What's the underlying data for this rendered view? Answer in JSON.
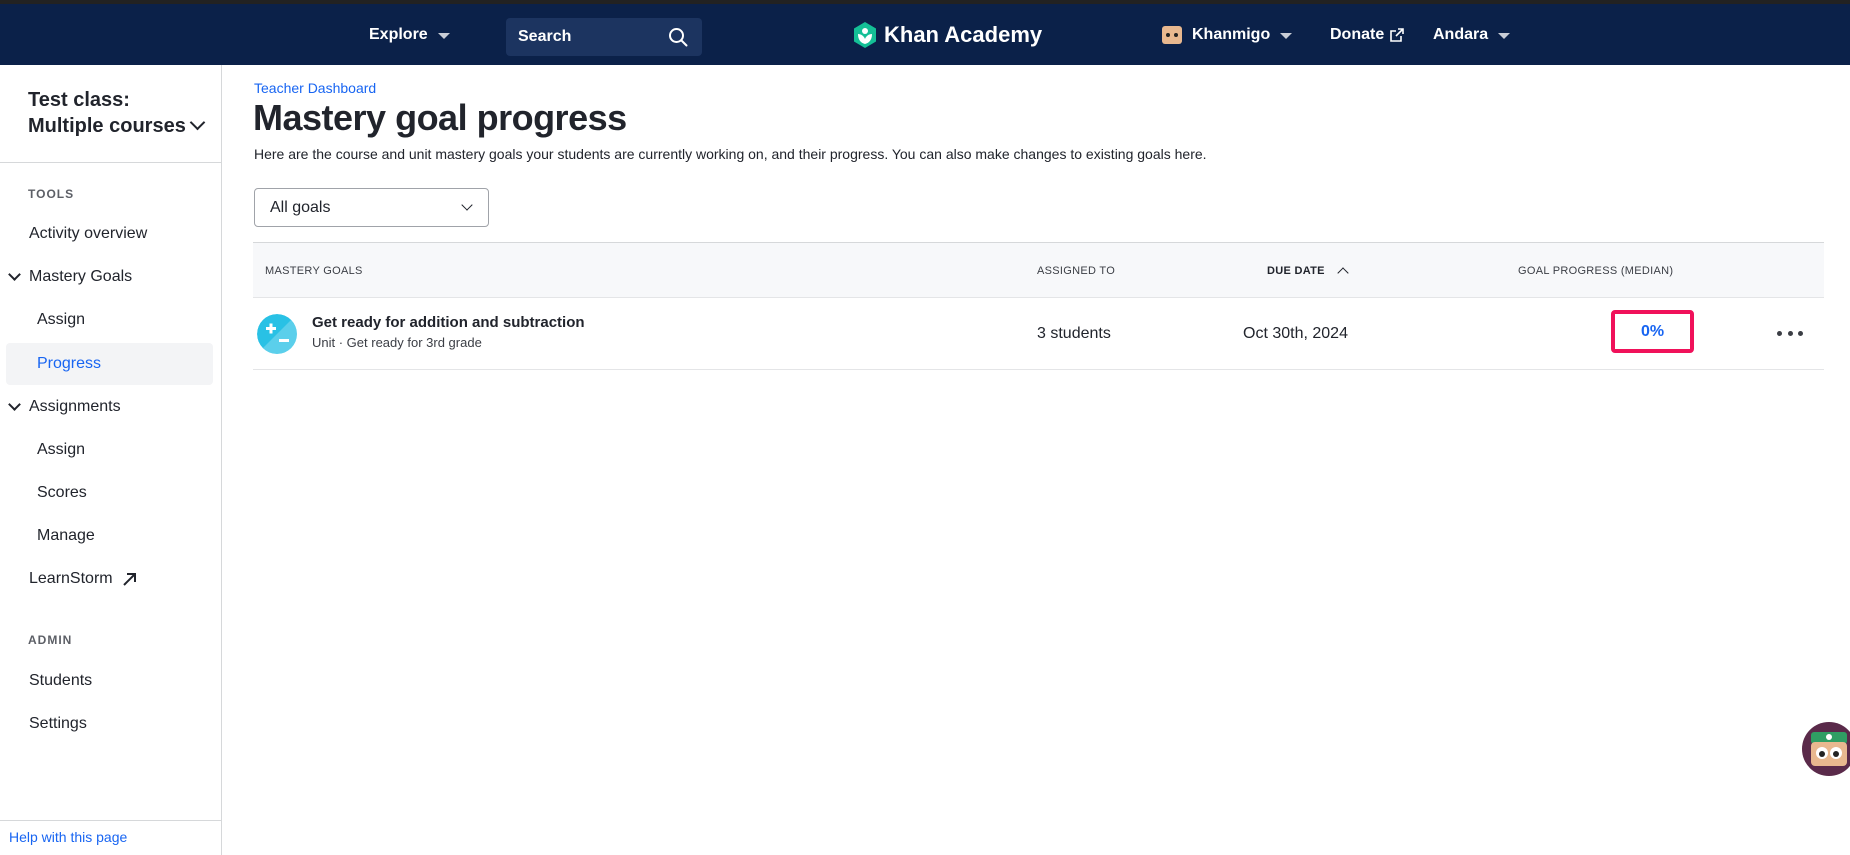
{
  "topnav": {
    "explore": "Explore",
    "search_label": "Search",
    "logo_text": "Khan Academy",
    "khanmigo": "Khanmigo",
    "donate": "Donate",
    "user": "Andara"
  },
  "sidebar": {
    "class_title": "Test class: Multiple courses",
    "tools_label": "TOOLS",
    "admin_label": "ADMIN",
    "items": {
      "activity_overview": "Activity overview",
      "mastery_goals": "Mastery Goals",
      "mg_assign": "Assign",
      "mg_progress": "Progress",
      "assignments": "Assignments",
      "as_assign": "Assign",
      "as_scores": "Scores",
      "as_manage": "Manage",
      "learnstorm": "LearnStorm",
      "students": "Students",
      "settings": "Settings"
    },
    "help": "Help with this page"
  },
  "main": {
    "breadcrumb": "Teacher Dashboard",
    "title": "Mastery goal progress",
    "description": "Here are the course and unit mastery goals your students are currently working on, and their progress. You can also make changes to existing goals here.",
    "filter_value": "All goals",
    "table": {
      "headers": {
        "goals": "MASTERY GOALS",
        "assigned": "ASSIGNED TO",
        "due": "DUE DATE",
        "progress": "GOAL PROGRESS (MEDIAN)"
      },
      "rows": [
        {
          "title": "Get ready for addition and subtraction",
          "subtitle": "Unit · Get ready for 3rd grade",
          "assigned": "3 students",
          "due": "Oct 30th, 2024",
          "progress": "0%"
        }
      ]
    }
  },
  "colors": {
    "nav_bg": "#0b2149",
    "link_blue": "#1865f2",
    "highlight_pink": "#f0115a",
    "logo_green": "#14bf96"
  }
}
